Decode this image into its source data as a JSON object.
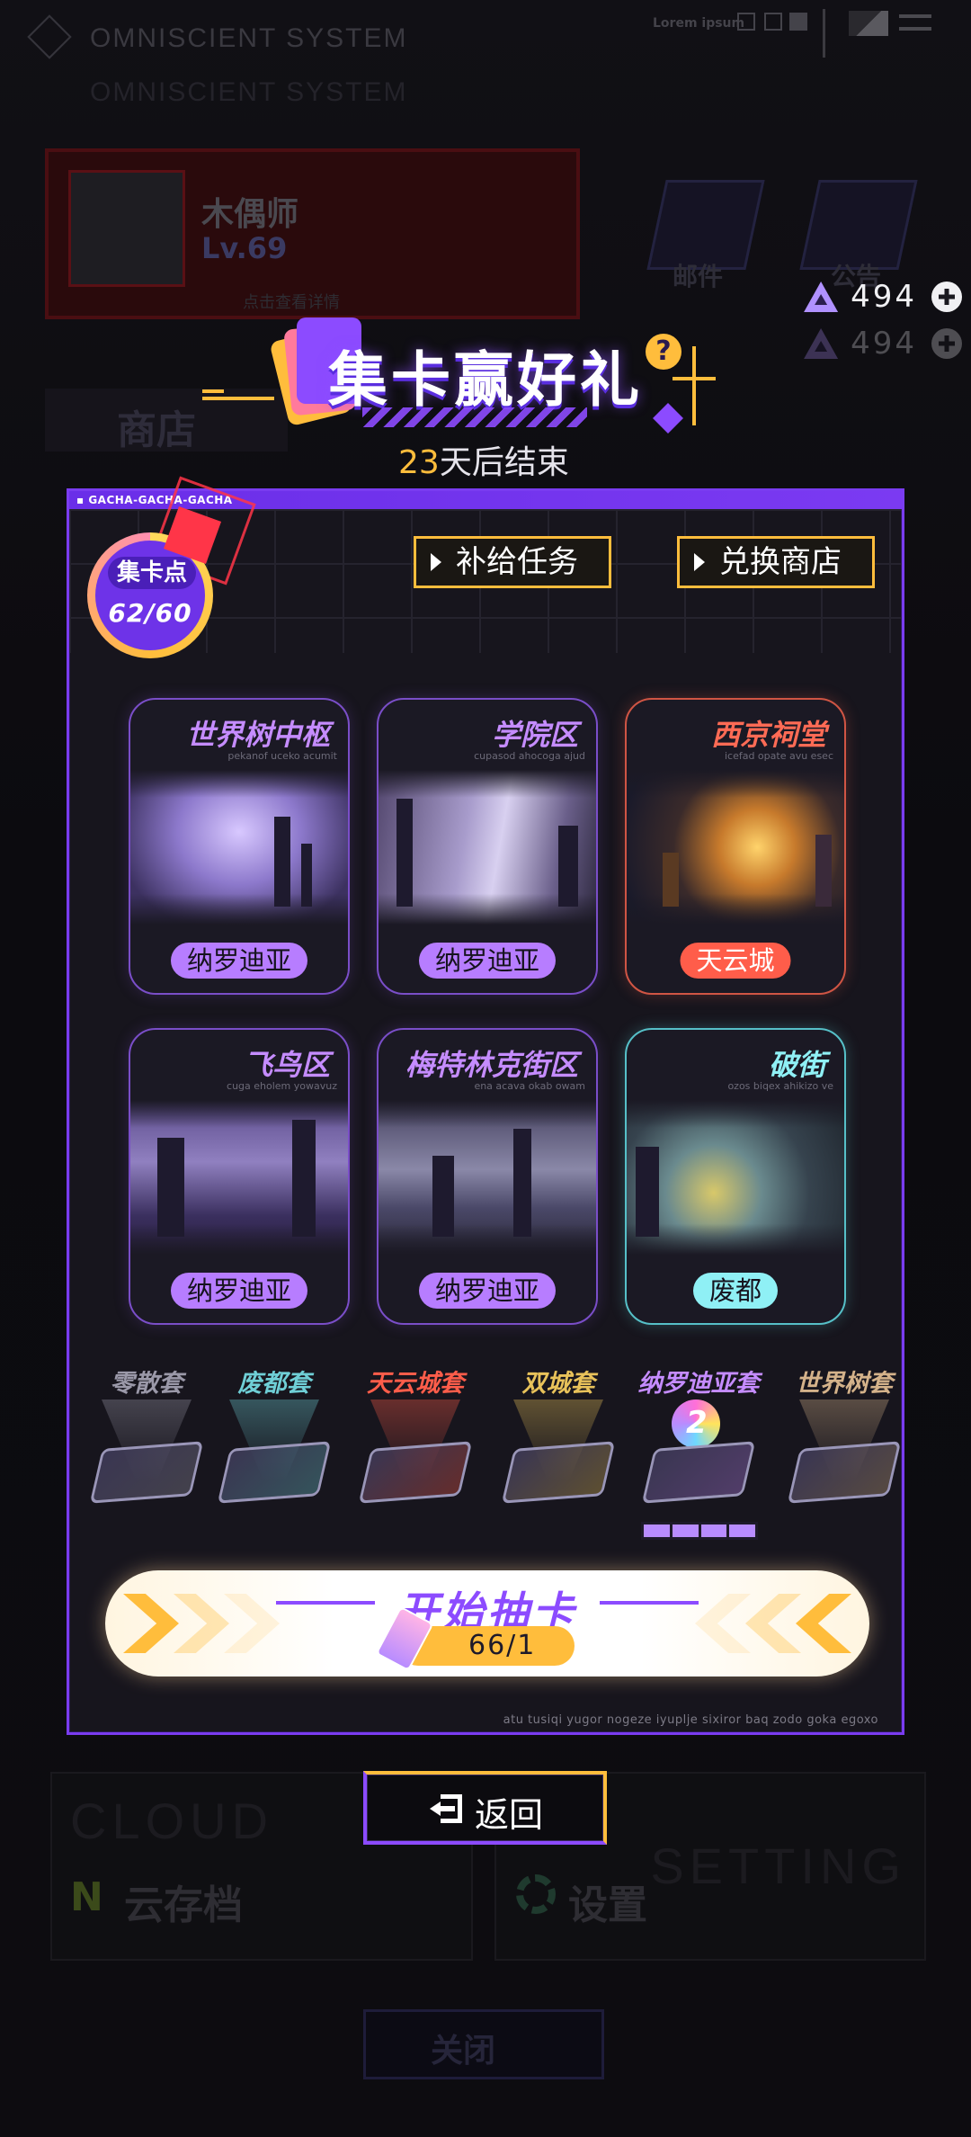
{
  "background": {
    "system_title": "OMNISCIENT SYSTEM",
    "lorem": "Lorem ipsum",
    "player_name": "木偶师",
    "player_level": "Lv.69",
    "player_sub": "点击查看详情",
    "feature_mail": "邮件",
    "feature_notice": "公告",
    "shop_label": "商店",
    "cloud_title": "CLOUD",
    "cloud_label": "云存档",
    "setting_title": "SETTING",
    "setting_label": "设置",
    "close_label": "关闭"
  },
  "currency": {
    "icon": "gem-icon",
    "value": "494"
  },
  "event": {
    "title": "集卡赢好礼",
    "days_num": "23",
    "days_suffix": "天后结束"
  },
  "panel": {
    "tag": "GACHA-GACHA-GACHA",
    "footer": "atu tusiqi yugor nogeze iyuplje sixiror baq zodo goka egoxo",
    "points_label": "集卡点",
    "points_value": "62/60",
    "supply_button": "补给任务",
    "exchange_button": "兑换商店"
  },
  "districts": [
    {
      "title": "世界树中枢",
      "sub": "pekanof uceko acumit",
      "tag": "纳罗迪亚"
    },
    {
      "title": "学院区",
      "sub": "cupasod ahocoga ajud",
      "tag": "纳罗迪亚"
    },
    {
      "title": "西京祠堂",
      "sub": "icefad opate avu esec",
      "tag": "天云城"
    },
    {
      "title": "飞鸟区",
      "sub": "cuga eholem yowavuz",
      "tag": "纳罗迪亚"
    },
    {
      "title": "梅特林克街区",
      "sub": "ena acava okab owam",
      "tag": "纳罗迪亚"
    },
    {
      "title": "破街",
      "sub": "ozos biqex ahikizo ve",
      "tag": "废都"
    }
  ],
  "sets": [
    {
      "title": "零散套",
      "color": "#9a98a8"
    },
    {
      "title": "废都套",
      "color": "#6fcfd6"
    },
    {
      "title": "天云城套",
      "color": "#ff5d4a"
    },
    {
      "title": "双城套",
      "color": "#e8c25a"
    },
    {
      "title": "纳罗迪亚套",
      "color": "#c58cff"
    },
    {
      "title": "世界树套",
      "color": "#d4b28a"
    }
  ],
  "set_progress": 1.0,
  "set_level": "2",
  "draw": {
    "label": "开始抽卡",
    "cost": "66/1",
    "ticket_icon": "ticket-icon"
  },
  "back": {
    "label": "返回",
    "icon": "exit-icon"
  },
  "colors": {
    "accent_purple": "#8c4bff",
    "accent_gold": "#ffbd3c",
    "accent_red": "#ff5d4a",
    "accent_teal": "#8ff0f5"
  }
}
